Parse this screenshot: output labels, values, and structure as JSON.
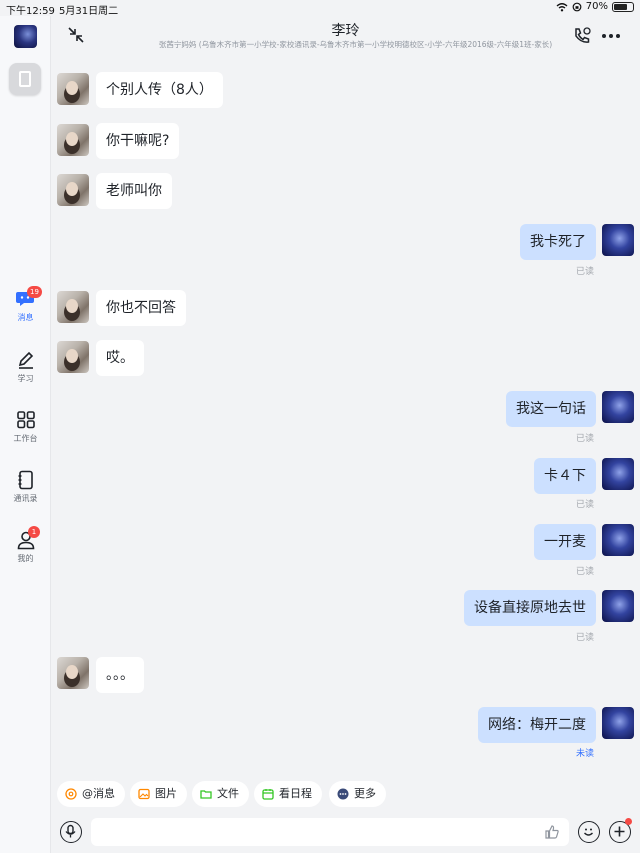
{
  "status_bar": {
    "time": "下午12:59",
    "date": "5月31日周二",
    "battery": "70%",
    "battery_level": 0.7
  },
  "sidebar": {
    "items": [
      {
        "label": "消息",
        "badge": "19",
        "active": true
      },
      {
        "label": "学习",
        "badge": ""
      },
      {
        "label": "工作台",
        "badge": ""
      },
      {
        "label": "通讯录",
        "badge": ""
      },
      {
        "label": "我的",
        "badge": "1"
      }
    ]
  },
  "header": {
    "title": "李玲",
    "subtitle": "张茜宁妈妈 (乌鲁木齐市第一小学校-家校通讯录-乌鲁木齐市第一小学校明德校区-小学-六年级2016级-六年级1班-家长)"
  },
  "messages": [
    {
      "side": "left",
      "text": "个别人传（8人）"
    },
    {
      "side": "left",
      "text": "你干嘛呢?"
    },
    {
      "side": "left",
      "text": "老师叫你"
    },
    {
      "side": "right",
      "text": "我卡死了",
      "status": "已读"
    },
    {
      "side": "left",
      "text": "你也不回答"
    },
    {
      "side": "left",
      "text": "哎。"
    },
    {
      "side": "right",
      "text": "我这一句话",
      "status": "已读"
    },
    {
      "side": "right",
      "text": "卡４下",
      "status": "已读"
    },
    {
      "side": "right",
      "text": "一开麦",
      "status": "已读"
    },
    {
      "side": "right",
      "text": "设备直接原地去世",
      "status": "已读"
    },
    {
      "side": "left",
      "text": "。。。"
    },
    {
      "side": "right",
      "text": "网络：梅开二度",
      "status": "未读"
    }
  ],
  "quick_actions": [
    {
      "label": "@消息",
      "icon": "at-icon",
      "color": "#ff8800"
    },
    {
      "label": "图片",
      "icon": "image-icon",
      "color": "#ff8800"
    },
    {
      "label": "文件",
      "icon": "folder-icon",
      "color": "#34c724"
    },
    {
      "label": "看日程",
      "icon": "calendar-icon",
      "color": "#34c724"
    },
    {
      "label": "更多",
      "icon": "more-icon",
      "color": "#3a4a78"
    }
  ],
  "input": {
    "placeholder": ""
  },
  "colors": {
    "accent": "#3370ff",
    "self_bubble": "#cce0ff",
    "badge": "#f54a45"
  }
}
